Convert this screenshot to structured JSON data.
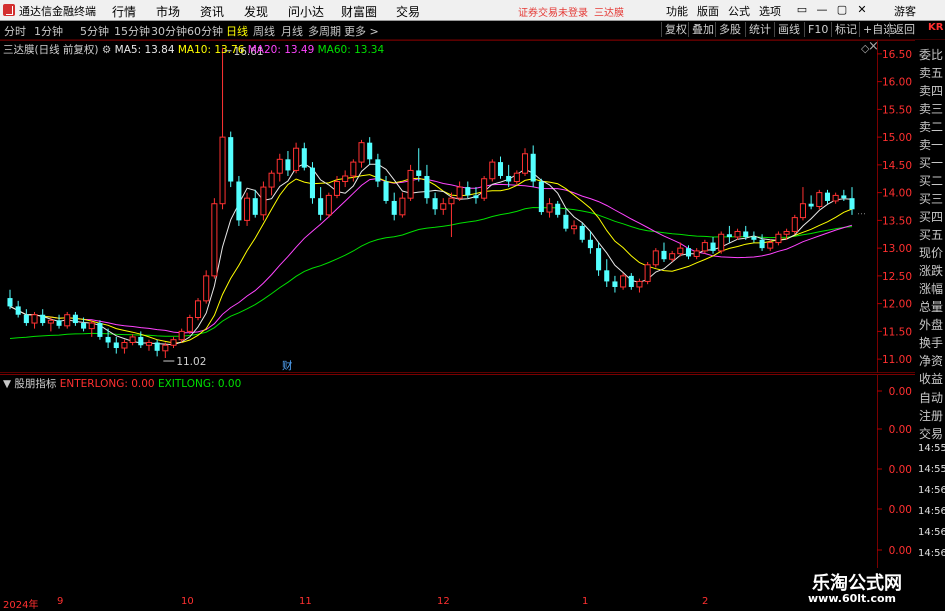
{
  "app": {
    "title": "通达信金融终端",
    "menu": [
      "行情",
      "市场",
      "资讯",
      "发现",
      "问小达",
      "财富圈",
      "交易"
    ],
    "login_warning": "证券交易未登录",
    "stock_name": "三达膜",
    "right_menu": [
      "功能",
      "版面",
      "公式",
      "选项"
    ],
    "guest": "游客",
    "window_buttons": [
      "▭",
      "—",
      "▢",
      "✕"
    ]
  },
  "periods": {
    "tabs": [
      "分时",
      "1分钟",
      "5分钟",
      "15分钟",
      "30分钟",
      "60分钟",
      "日线",
      "周线",
      "月线",
      "多周期",
      "更多 >"
    ],
    "active": "日线",
    "tools": [
      "复权",
      "叠加",
      "多股",
      "统计",
      "画线",
      "F10",
      "标记",
      "+自选",
      "返回"
    ]
  },
  "chart": {
    "title": "三达膜(日线 前复权)",
    "ma": [
      {
        "label": "MA5: 13.84",
        "color": "#e8e8e8"
      },
      {
        "label": "MA10: 13.76",
        "color": "#ffff00"
      },
      {
        "label": "MA20: 13.49",
        "color": "#ff44ff"
      },
      {
        "label": "MA60: 13.34",
        "color": "#00e000"
      }
    ],
    "high_label": "16.61",
    "low_label": "11.02",
    "event_marker": "财",
    "price_ticks": [
      "16.50",
      "16.00",
      "15.50",
      "15.00",
      "14.50",
      "14.00",
      "13.50",
      "13.00",
      "12.50",
      "12.00",
      "11.50",
      "11.00"
    ]
  },
  "indicator": {
    "name": "股朋指标",
    "params": [
      {
        "label": "ENTERLONG: 0.00",
        "color": "#ff3030"
      },
      {
        "label": "EXITLONG: 0.00",
        "color": "#00e000"
      }
    ],
    "ticks": [
      "0.00",
      "0.00",
      "0.00",
      "0.00",
      "0.00",
      "0.00"
    ]
  },
  "side_panel": {
    "kr": "KR",
    "items": [
      "委比",
      "卖五",
      "卖四",
      "卖三",
      "卖二",
      "卖一",
      "买一",
      "买二",
      "买三",
      "买四",
      "买五",
      "现价",
      "涨跌",
      "涨幅",
      "总量",
      "外盘",
      "换手",
      "净资",
      "收益",
      "自动",
      "注册",
      "交易",
      "14:55",
      "14:55",
      "14:56",
      "14:56",
      "14:56",
      "14:56",
      "14:56"
    ]
  },
  "time_axis": {
    "labels": [
      "2024年",
      "9",
      "10",
      "11",
      "12",
      "1",
      "2"
    ]
  },
  "watermark": {
    "line1": "乐淘公式网",
    "line2": "www.60lt.com"
  },
  "chart_data": {
    "type": "candlestick",
    "ylim": [
      10.75,
      16.75
    ],
    "ohlc": [
      [
        12.1,
        12.25,
        11.9,
        11.95
      ],
      [
        11.95,
        12.05,
        11.75,
        11.8
      ],
      [
        11.8,
        11.9,
        11.6,
        11.65
      ],
      [
        11.65,
        11.85,
        11.55,
        11.8
      ],
      [
        11.8,
        11.9,
        11.6,
        11.65
      ],
      [
        11.65,
        11.75,
        11.5,
        11.7
      ],
      [
        11.7,
        11.8,
        11.55,
        11.6
      ],
      [
        11.6,
        11.85,
        11.55,
        11.8
      ],
      [
        11.8,
        11.85,
        11.6,
        11.65
      ],
      [
        11.65,
        11.75,
        11.5,
        11.55
      ],
      [
        11.55,
        11.7,
        11.4,
        11.65
      ],
      [
        11.65,
        11.7,
        11.35,
        11.4
      ],
      [
        11.4,
        11.55,
        11.2,
        11.3
      ],
      [
        11.3,
        11.4,
        11.1,
        11.2
      ],
      [
        11.2,
        11.35,
        11.1,
        11.3
      ],
      [
        11.3,
        11.45,
        11.25,
        11.4
      ],
      [
        11.4,
        11.5,
        11.2,
        11.25
      ],
      [
        11.25,
        11.35,
        11.15,
        11.3
      ],
      [
        11.3,
        11.35,
        11.05,
        11.15
      ],
      [
        11.15,
        11.3,
        11.02,
        11.25
      ],
      [
        11.25,
        11.4,
        11.2,
        11.35
      ],
      [
        11.35,
        11.55,
        11.3,
        11.5
      ],
      [
        11.5,
        11.8,
        11.45,
        11.75
      ],
      [
        11.75,
        12.1,
        11.7,
        12.05
      ],
      [
        12.05,
        12.6,
        12.0,
        12.5
      ],
      [
        12.5,
        13.9,
        12.45,
        13.8
      ],
      [
        13.8,
        16.61,
        13.7,
        15.0
      ],
      [
        15.0,
        15.1,
        14.1,
        14.2
      ],
      [
        14.2,
        14.3,
        13.4,
        13.5
      ],
      [
        13.5,
        14.0,
        13.4,
        13.9
      ],
      [
        13.9,
        14.05,
        13.55,
        13.6
      ],
      [
        13.6,
        14.2,
        13.5,
        14.1
      ],
      [
        14.1,
        14.4,
        13.95,
        14.35
      ],
      [
        14.35,
        14.7,
        14.2,
        14.6
      ],
      [
        14.6,
        14.75,
        14.3,
        14.4
      ],
      [
        14.4,
        14.9,
        14.35,
        14.8
      ],
      [
        14.8,
        14.9,
        14.4,
        14.45
      ],
      [
        14.45,
        14.55,
        13.8,
        13.9
      ],
      [
        13.9,
        14.1,
        13.5,
        13.6
      ],
      [
        13.6,
        14.0,
        13.55,
        13.95
      ],
      [
        13.95,
        14.3,
        13.9,
        14.2
      ],
      [
        14.2,
        14.4,
        14.1,
        14.3
      ],
      [
        14.3,
        14.6,
        14.2,
        14.55
      ],
      [
        14.55,
        14.95,
        14.45,
        14.9
      ],
      [
        14.9,
        15.0,
        14.5,
        14.6
      ],
      [
        14.6,
        14.7,
        14.1,
        14.2
      ],
      [
        14.2,
        14.3,
        13.8,
        13.85
      ],
      [
        13.85,
        14.0,
        13.5,
        13.6
      ],
      [
        13.6,
        14.0,
        13.55,
        13.9
      ],
      [
        13.9,
        14.5,
        13.85,
        14.4
      ],
      [
        14.4,
        14.8,
        14.2,
        14.3
      ],
      [
        14.3,
        14.5,
        13.8,
        13.9
      ],
      [
        13.9,
        14.0,
        13.6,
        13.7
      ],
      [
        13.7,
        13.9,
        13.6,
        13.8
      ],
      [
        13.8,
        14.0,
        13.2,
        13.9
      ],
      [
        13.9,
        14.2,
        13.85,
        14.1
      ],
      [
        14.1,
        14.2,
        13.9,
        13.95
      ],
      [
        13.95,
        14.1,
        13.8,
        13.9
      ],
      [
        13.9,
        14.3,
        13.85,
        14.25
      ],
      [
        14.25,
        14.6,
        14.2,
        14.55
      ],
      [
        14.55,
        14.65,
        14.25,
        14.3
      ],
      [
        14.3,
        14.5,
        14.1,
        14.2
      ],
      [
        14.2,
        14.4,
        14.15,
        14.35
      ],
      [
        14.35,
        14.8,
        14.3,
        14.7
      ],
      [
        14.7,
        14.85,
        14.1,
        14.2
      ],
      [
        14.2,
        14.25,
        13.6,
        13.65
      ],
      [
        13.65,
        13.9,
        13.55,
        13.8
      ],
      [
        13.8,
        13.85,
        13.55,
        13.6
      ],
      [
        13.6,
        13.7,
        13.3,
        13.35
      ],
      [
        13.35,
        13.5,
        13.25,
        13.4
      ],
      [
        13.4,
        13.45,
        13.1,
        13.15
      ],
      [
        13.15,
        13.3,
        12.9,
        13.0
      ],
      [
        13.0,
        13.1,
        12.5,
        12.6
      ],
      [
        12.6,
        12.8,
        12.3,
        12.4
      ],
      [
        12.4,
        12.5,
        12.2,
        12.3
      ],
      [
        12.3,
        12.55,
        12.25,
        12.5
      ],
      [
        12.5,
        12.55,
        12.25,
        12.3
      ],
      [
        12.3,
        12.45,
        12.2,
        12.4
      ],
      [
        12.4,
        12.75,
        12.35,
        12.7
      ],
      [
        12.7,
        13.0,
        12.65,
        12.95
      ],
      [
        12.95,
        13.1,
        12.75,
        12.8
      ],
      [
        12.8,
        12.95,
        12.75,
        12.9
      ],
      [
        12.9,
        13.1,
        12.85,
        13.0
      ],
      [
        13.0,
        13.05,
        12.8,
        12.85
      ],
      [
        12.85,
        13.0,
        12.8,
        12.95
      ],
      [
        12.95,
        13.15,
        12.9,
        13.1
      ],
      [
        13.1,
        13.2,
        12.9,
        12.95
      ],
      [
        12.95,
        13.3,
        12.9,
        13.25
      ],
      [
        13.25,
        13.4,
        13.1,
        13.2
      ],
      [
        13.2,
        13.35,
        13.15,
        13.3
      ],
      [
        13.3,
        13.4,
        13.15,
        13.2
      ],
      [
        13.2,
        13.3,
        13.1,
        13.15
      ],
      [
        13.15,
        13.25,
        12.95,
        13.0
      ],
      [
        13.0,
        13.15,
        12.95,
        13.1
      ],
      [
        13.1,
        13.3,
        13.05,
        13.25
      ],
      [
        13.25,
        13.35,
        13.15,
        13.3
      ],
      [
        13.3,
        13.6,
        13.25,
        13.55
      ],
      [
        13.55,
        14.1,
        13.5,
        13.8
      ],
      [
        13.8,
        13.95,
        13.7,
        13.75
      ],
      [
        13.75,
        14.05,
        13.7,
        14.0
      ],
      [
        14.0,
        14.05,
        13.8,
        13.85
      ],
      [
        13.85,
        14.0,
        13.8,
        13.95
      ],
      [
        13.95,
        14.05,
        13.85,
        13.9
      ],
      [
        13.9,
        14.1,
        13.6,
        13.7
      ]
    ],
    "ma5_color": "#e8e8e8",
    "ma10_color": "#ffff00",
    "ma20_color": "#ff44ff",
    "ma60_color": "#00e000"
  }
}
